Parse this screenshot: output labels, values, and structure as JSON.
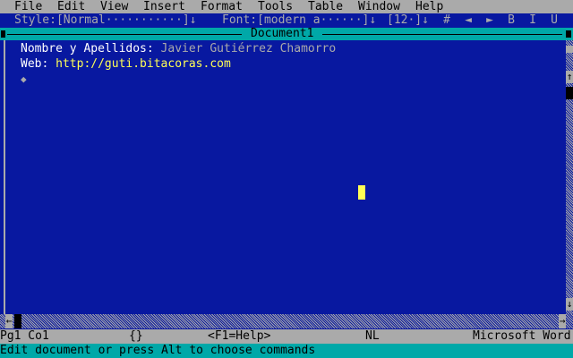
{
  "menu": [
    "File",
    "Edit",
    "View",
    "Insert",
    "Format",
    "Tools",
    "Table",
    "Window",
    "Help"
  ],
  "ribbon": {
    "style": "Style:[Normal···········]↓",
    "font": "Font:[modern a······]↓",
    "size": "[12·]↓",
    "buttons": [
      "#",
      "◄",
      "►",
      "B",
      "I",
      "U"
    ]
  },
  "window": {
    "title": "Document1"
  },
  "document": {
    "line1_label": "Nombre y Apellidos:",
    "line1_value": "Javier Gutiérrez Chamorro",
    "line2_label": "Web:",
    "line2_value": "http://guti.bitacoras.com",
    "end_mark": "◆"
  },
  "scroll": {
    "up": "↑",
    "down": "↓",
    "left": "←",
    "right": "→"
  },
  "status": {
    "position": "Pg1 Co1",
    "braces": "{}",
    "help": "<F1=Help>",
    "mode": "NL",
    "app": "Microsoft Word"
  },
  "message": "Edit document or press Alt to choose commands"
}
